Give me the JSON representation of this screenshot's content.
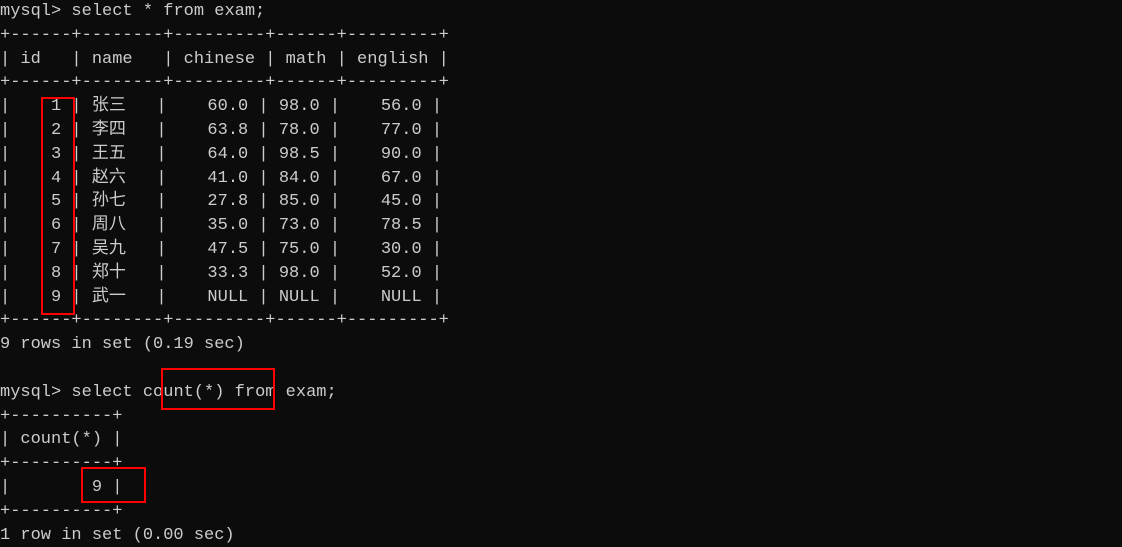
{
  "query1": {
    "prompt": "mysql> ",
    "statement": "select * from exam;",
    "columns": [
      "id",
      "name",
      "chinese",
      "math",
      "english"
    ],
    "rows": [
      {
        "id": "1",
        "name": "张三",
        "chinese": "60.0",
        "math": "98.0",
        "english": "56.0"
      },
      {
        "id": "2",
        "name": "李四",
        "chinese": "63.8",
        "math": "78.0",
        "english": "77.0"
      },
      {
        "id": "3",
        "name": "王五",
        "chinese": "64.0",
        "math": "98.5",
        "english": "90.0"
      },
      {
        "id": "4",
        "name": "赵六",
        "chinese": "41.0",
        "math": "84.0",
        "english": "67.0"
      },
      {
        "id": "5",
        "name": "孙七",
        "chinese": "27.8",
        "math": "85.0",
        "english": "45.0"
      },
      {
        "id": "6",
        "name": "周八",
        "chinese": "35.0",
        "math": "73.0",
        "english": "78.5"
      },
      {
        "id": "7",
        "name": "吴九",
        "chinese": "47.5",
        "math": "75.0",
        "english": "30.0"
      },
      {
        "id": "8",
        "name": "郑十",
        "chinese": "33.3",
        "math": "98.0",
        "english": "52.0"
      },
      {
        "id": "9",
        "name": "武一",
        "chinese": "NULL",
        "math": "NULL",
        "english": "NULL"
      }
    ],
    "footer": "9 rows in set (0.19 sec)"
  },
  "query2": {
    "prompt": "mysql> ",
    "statement_parts": {
      "pre": "select ",
      "highlighted": "count(*)",
      "post": " from exam;"
    },
    "column": "count(*)",
    "value": "9",
    "footer": "1 row in set (0.00 sec)"
  },
  "table_borders": {
    "top1": "+------+--------+---------+------+---------+",
    "header1": "| id   | name   | chinese | math | english |",
    "sep1": "+------+--------+---------+------+---------+",
    "bottom1": "+------+--------+---------+------+---------+",
    "top2": "+----------+",
    "header2": "| count(*) |",
    "sep2": "+----------+",
    "value2": "|        9 |",
    "bottom2": "+----------+"
  }
}
